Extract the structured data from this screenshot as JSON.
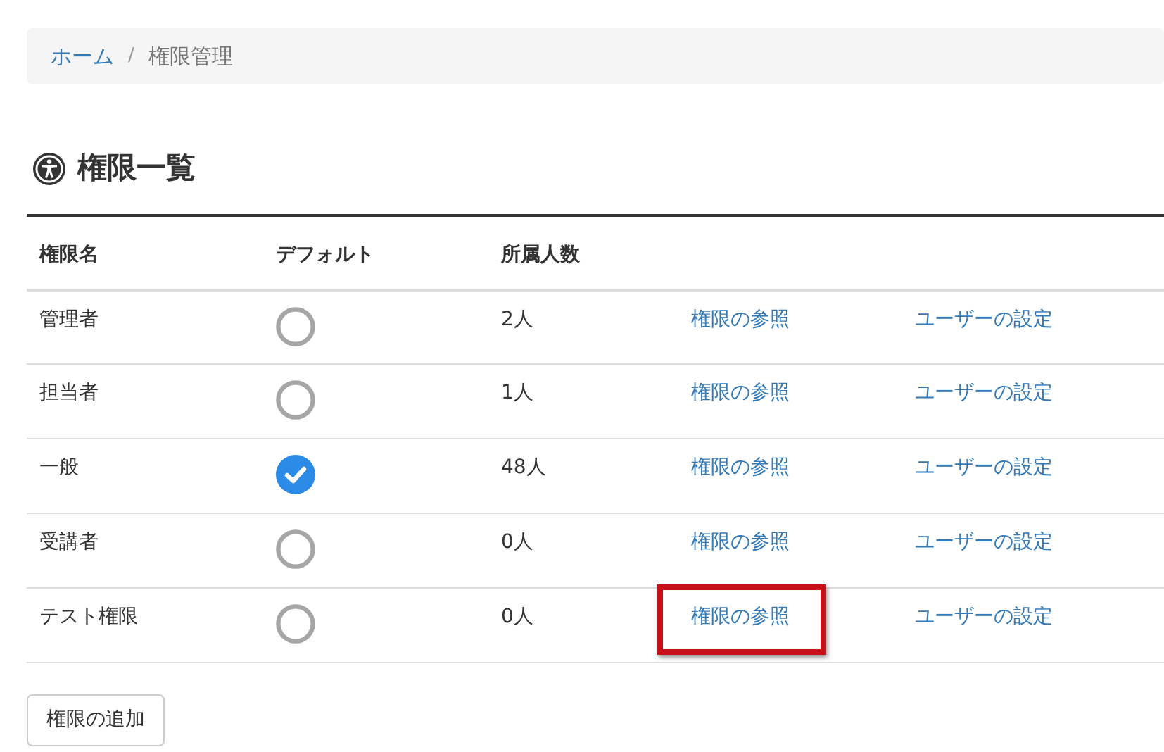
{
  "breadcrumb": [
    {
      "label": "ホーム",
      "link": true
    },
    {
      "label": "権限管理",
      "link": false
    }
  ],
  "breadcrumb_separator": "/",
  "heading": "権限一覧",
  "table": {
    "columns": [
      "権限名",
      "デフォルト",
      "所属人数"
    ],
    "rows": [
      {
        "name": "管理者",
        "default": false,
        "members": "2人",
        "view_link": "権限の参照",
        "view_highlighted": false,
        "users_link": "ユーザーの設定"
      },
      {
        "name": "担当者",
        "default": false,
        "members": "1人",
        "view_link": "権限の参照",
        "view_highlighted": false,
        "users_link": "ユーザーの設定"
      },
      {
        "name": "一般",
        "default": true,
        "members": "48人",
        "view_link": "権限の参照",
        "view_highlighted": false,
        "users_link": "ユーザーの設定"
      },
      {
        "name": "受講者",
        "default": false,
        "members": "0人",
        "view_link": "権限の参照",
        "view_highlighted": false,
        "users_link": "ユーザーの設定"
      },
      {
        "name": "テスト権限",
        "default": false,
        "members": "0人",
        "view_link": "権限の参照",
        "view_highlighted": true,
        "users_link": "ユーザーの設定"
      }
    ]
  },
  "add_button": "権限の追加"
}
